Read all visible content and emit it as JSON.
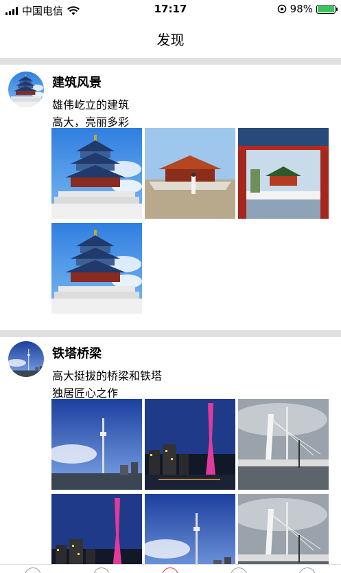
{
  "status_bar": {
    "carrier": "中国电信",
    "time": "17:17",
    "battery": "98%",
    "battery_level": 0.98,
    "icons": [
      "signal-icon",
      "wifi-icon",
      "orientation-lock-icon",
      "battery-icon"
    ]
  },
  "nav": {
    "title": "发现"
  },
  "posts": [
    {
      "title": "建筑风景",
      "lines": [
        "雄伟屹立的建筑",
        "高大，亮丽多彩"
      ],
      "images": [
        "temple-of-heaven",
        "forbidden-city-hall",
        "pavilion-gate",
        "temple-of-heaven"
      ]
    },
    {
      "title": "铁塔桥梁",
      "lines": [
        "高大挺拔的桥梁和铁塔",
        "独居匠心之作"
      ],
      "images": [
        "tv-tower-skyline",
        "canton-tower-night",
        "cable-bridge",
        "canton-tower-night",
        "tv-tower-skyline",
        "cable-bridge"
      ]
    }
  ],
  "colors": {
    "divider": "#e0e0e0",
    "battery_fill": "#34c759",
    "sky": "#3a8ee6"
  }
}
